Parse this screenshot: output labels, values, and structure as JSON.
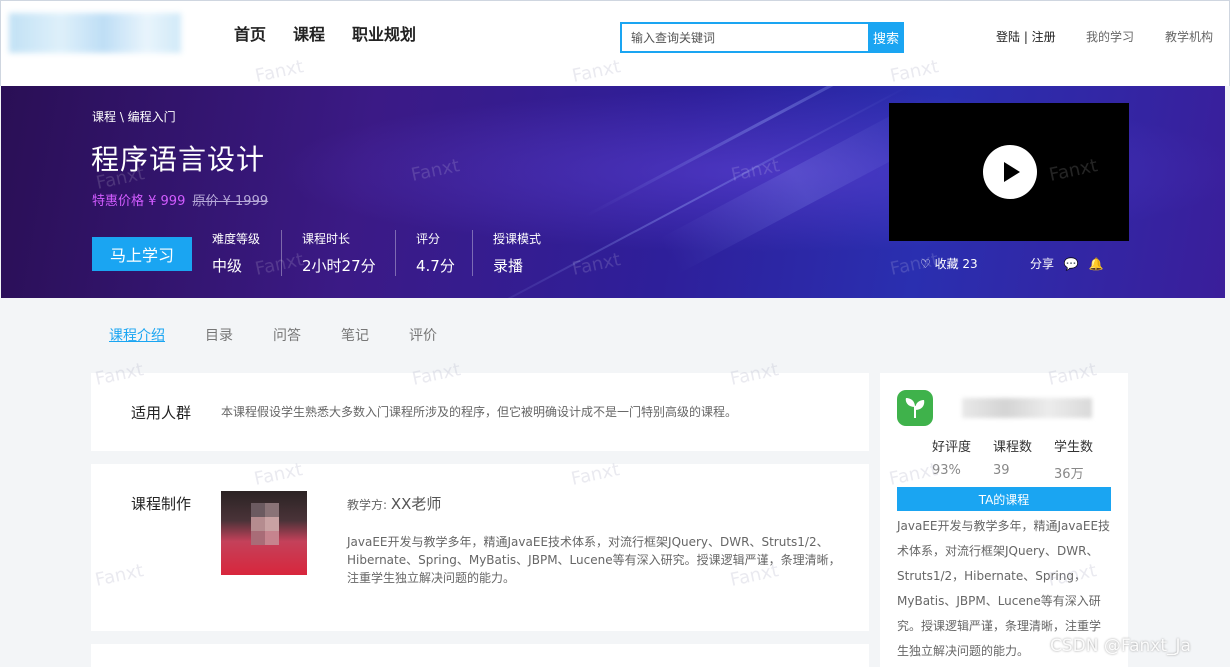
{
  "nav": {
    "items": [
      "首页",
      "课程",
      "职业规划"
    ]
  },
  "search": {
    "placeholder": "输入查询关键词",
    "button": "搜索"
  },
  "top_links": {
    "login": "登陆 | 注册",
    "my_learning": "我的学习",
    "institutions": "教学机构"
  },
  "course": {
    "breadcrumb": "课程 \\ 编程入门",
    "title": "程序语言设计",
    "sale_price": "特惠价格 ¥ 999",
    "original_price": "原价 ¥ 1999",
    "study_button": "马上学习",
    "meta": [
      {
        "label": "难度等级",
        "value": "中级"
      },
      {
        "label": "课程时长",
        "value": "2小时27分"
      },
      {
        "label": "评分",
        "value": "4.7分"
      },
      {
        "label": "授课模式",
        "value": "录播"
      }
    ],
    "favorite": "♡ 收藏 23",
    "share": "分享"
  },
  "tabs": [
    "课程介绍",
    "目录",
    "问答",
    "笔记",
    "评价"
  ],
  "audience": {
    "label": "适用人群",
    "text": "本课程假设学生熟悉大多数入门课程所涉及的程序，但它被明确设计成不是一门特别高级的课程。"
  },
  "production": {
    "label": "课程制作",
    "teacher_prefix": "教学方:",
    "teacher_name": "XX老师",
    "bio": "JavaEE开发与教学多年，精通JavaEE技术体系，对流行框架JQuery、DWR、Struts1/2、Hibernate、Spring、MyBatis、JBPM、Lucene等有深入研究。授课逻辑严谨，条理清晰，注重学生独立解决问题的能力。"
  },
  "institution": {
    "stats": [
      {
        "label": "好评度",
        "value": "93%"
      },
      {
        "label": "课程数",
        "value": "39"
      },
      {
        "label": "学生数",
        "value": "36万"
      }
    ],
    "ta_courses_button": "TA的课程",
    "bio": "JavaEE开发与教学多年，精通JavaEE技术体系，对流行框架JQuery、DWR、Struts1/2，Hibernate、Spring，MyBatis、JBPM、Lucene等有深入研究。授课逻辑严谨，条理清晰，注重学生独立解决问题的能力。"
  },
  "watermark": "Fanxt",
  "csdn_mark": "CSDN @Fanxt_Ja",
  "colors": {
    "accent": "#1aa5f2",
    "sale_price": "#d25cff",
    "banner_dark": "#2a0f55",
    "banner_blue": "#2e1f9a"
  }
}
